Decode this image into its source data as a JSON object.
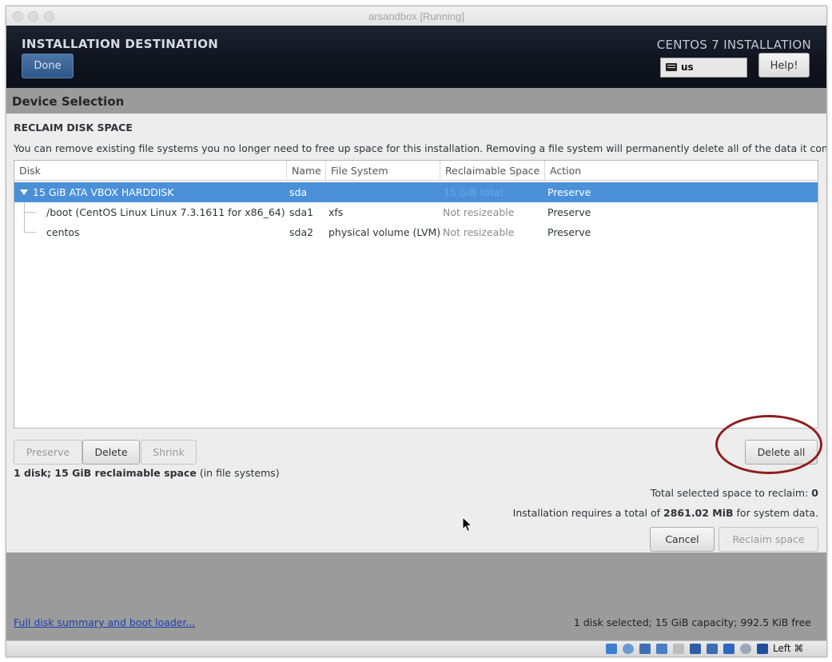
{
  "window": {
    "title": "arsandbox [Running]"
  },
  "header": {
    "title": "INSTALLATION DESTINATION",
    "done_label": "Done",
    "product": "CENTOS 7 INSTALLATION",
    "keyboard_layout": "us",
    "help_label": "Help!"
  },
  "device_selection": {
    "label": "Device Selection"
  },
  "dialog": {
    "title": "RECLAIM DISK SPACE",
    "description": "You can remove existing file systems you no longer need to free up space for this installation.  Removing a file system will permanently delete all of the data it contains.",
    "columns": [
      "Disk",
      "Name",
      "File System",
      "Reclaimable Space",
      "Action"
    ],
    "rows": [
      {
        "disk": "15 GiB ATA VBOX HARDDISK",
        "name": "sda",
        "fs": "",
        "reclaimable": "15 GiB total",
        "action": "Preserve"
      },
      {
        "disk": "/boot (CentOS Linux Linux 7.3.1611 for x86_64)",
        "name": "sda1",
        "fs": "xfs",
        "reclaimable": "Not resizeable",
        "action": "Preserve"
      },
      {
        "disk": "centos",
        "name": "sda2",
        "fs": "physical volume (LVM)",
        "reclaimable": "Not resizeable",
        "action": "Preserve"
      }
    ],
    "buttons": {
      "preserve": "Preserve",
      "delete": "Delete",
      "shrink": "Shrink",
      "delete_all": "Delete all",
      "cancel": "Cancel",
      "reclaim": "Reclaim space"
    },
    "summary_bold": "1 disk; 15 GiB reclaimable space",
    "summary_rest": " (in file systems)",
    "total_prefix": "Total selected space to reclaim: ",
    "total_value": "0",
    "requires_prefix": "Installation requires a total of ",
    "requires_value": "2861.02 MiB",
    "requires_suffix": " for system data."
  },
  "footer": {
    "link": "Full disk summary and boot loader...",
    "status": "1 disk selected; 15 GiB capacity; 992.5 KiB free"
  },
  "vbox_bar": {
    "host_key": "Left ⌘"
  },
  "colors": {
    "selection": "#4a90d9",
    "annotation_circle": "#8e1d1e",
    "header_bg": "#101520"
  }
}
